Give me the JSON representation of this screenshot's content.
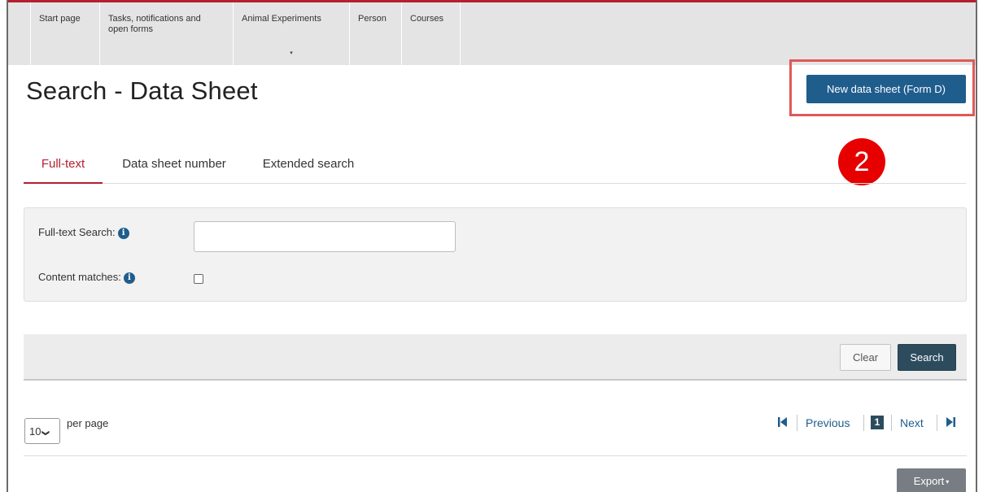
{
  "nav": {
    "items": [
      {
        "label": "Start page"
      },
      {
        "label": "Tasks, notifications and open forms"
      },
      {
        "label": "Animal Experiments",
        "has_dropdown": true
      },
      {
        "label": "Person"
      },
      {
        "label": "Courses"
      }
    ],
    "dropdown_caret": "▾"
  },
  "page": {
    "title": "Search - Data Sheet"
  },
  "actions": {
    "new_button": "New data sheet (Form D)"
  },
  "annotation": {
    "step_number": "2",
    "color": "#e60000",
    "highlight_color": "#e05858"
  },
  "tabs": [
    {
      "label": "Full-text",
      "active": true
    },
    {
      "label": "Data sheet number",
      "active": false
    },
    {
      "label": "Extended search",
      "active": false
    }
  ],
  "search": {
    "fulltext_label": "Full-text Search:",
    "fulltext_value": "",
    "content_matches_label": "Content matches:",
    "content_matches_checked": false,
    "info_icon": "i"
  },
  "buttons": {
    "clear": "Clear",
    "search": "Search"
  },
  "pagination": {
    "page_size": "10",
    "page_size_chevron": "❯",
    "per_page_label": "per page",
    "first_icon": "first-page-icon",
    "previous": "Previous",
    "current_page": "1",
    "next": "Next",
    "last_icon": "last-page-icon"
  },
  "export": {
    "label": "Export",
    "caret": "▾"
  },
  "colors": {
    "brand_red": "#b3202f",
    "primary_blue": "#1f5d8d",
    "dark_slate": "#2c4c5e"
  }
}
